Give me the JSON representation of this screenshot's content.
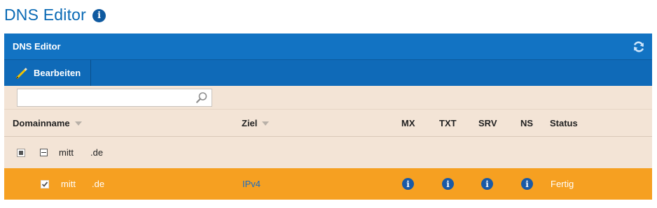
{
  "page": {
    "title": "DNS Editor",
    "info_icon": "info-circle-icon"
  },
  "panel": {
    "title": "DNS Editor",
    "refresh_icon": "refresh-icon"
  },
  "toolbar": {
    "edit_label": "Bearbeiten",
    "edit_icon": "pencil-icon"
  },
  "filter": {
    "search_value": "",
    "search_icon": "magnifier-icon"
  },
  "table": {
    "columns": {
      "domainname": "Domainname",
      "ziel": "Ziel",
      "mx": "MX",
      "txt": "TXT",
      "srv": "SRV",
      "ns": "NS",
      "status": "Status"
    },
    "rows": [
      {
        "type": "parent",
        "domain_part1": "mitt",
        "domain_part2": ".de",
        "selection": "partial",
        "expanded": true
      },
      {
        "type": "child",
        "domain_part1": "mitt",
        "domain_part2": ".de",
        "selection": "checked",
        "ziel": "IPv4",
        "mx_icon": "info-circle-icon",
        "txt_icon": "info-circle-icon",
        "srv_icon": "info-circle-icon",
        "ns_icon": "info-circle-icon",
        "status": "Fertig"
      }
    ]
  },
  "colors": {
    "title_blue": "#0a6ab5",
    "header_blue": "#1273c3",
    "toolbar_blue": "#0f6ab8",
    "beige": "#f3e4d6",
    "selected_orange": "#f6a021",
    "link_blue": "#1a6dc4",
    "info_icon_blue": "#1a5aa6"
  }
}
